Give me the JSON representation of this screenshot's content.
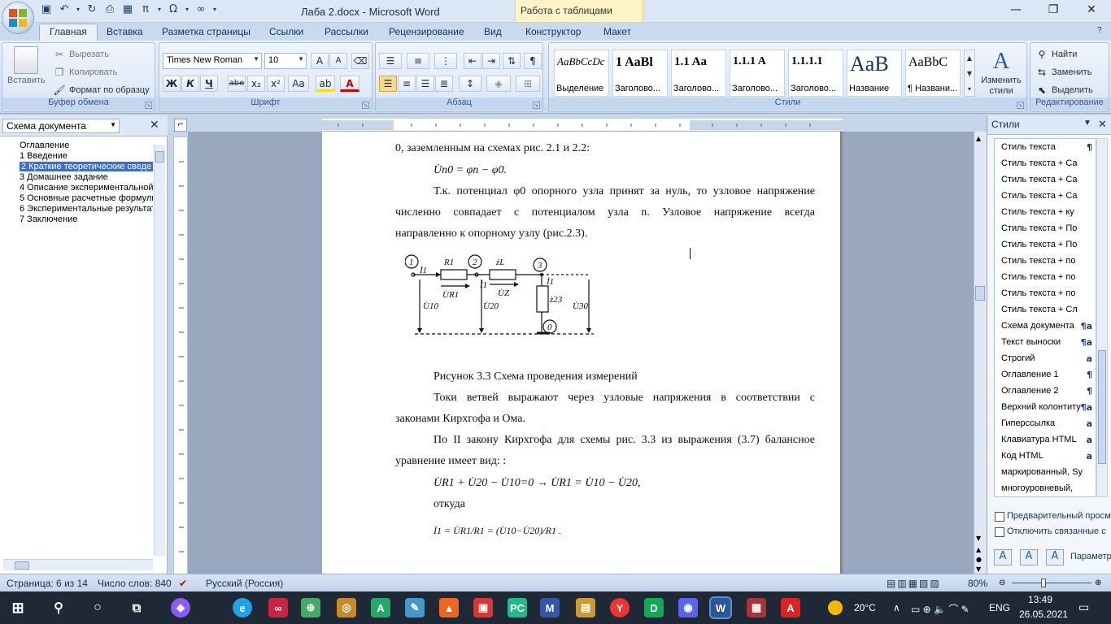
{
  "window": {
    "title": "Лаба 2.docx - Microsoft Word",
    "context_tab_group": "Работа с таблицами",
    "controls": {
      "minimize": "—",
      "restore": "❐",
      "close": "✕"
    }
  },
  "qat": {
    "undo_icon": "undo-icon",
    "redo_icon": "redo-icon",
    "pi": "π",
    "omega": "Ω",
    "inf": "∞"
  },
  "tabs": [
    "Главная",
    "Вставка",
    "Разметка страницы",
    "Ссылки",
    "Рассылки",
    "Рецензирование",
    "Вид",
    "Конструктор",
    "Макет"
  ],
  "ribbon": {
    "clipboard": {
      "label": "Буфер обмена",
      "paste": "Вставить",
      "cut": "Вырезать",
      "copy": "Копировать",
      "format_painter": "Формат по образцу"
    },
    "font": {
      "label": "Шрифт",
      "font_name": "Times New Roman",
      "font_size": "10",
      "bold": "Ж",
      "italic": "К",
      "underline": "Ч",
      "strike": "abe",
      "sub": "x₂",
      "sup": "x²",
      "case": "Aa",
      "grow": "A",
      "shrink": "A"
    },
    "paragraph": {
      "label": "Абзац"
    },
    "styles": {
      "label": "Стили",
      "items": [
        {
          "preview": "AaBbCcDc",
          "name": "Выделение"
        },
        {
          "preview": "1  AaBl",
          "name": "Заголово..."
        },
        {
          "preview": "1.1  Aa",
          "name": "Заголово..."
        },
        {
          "preview": "1.1.1  A",
          "name": "Заголово..."
        },
        {
          "preview": "1.1.1.1",
          "name": "Заголово..."
        },
        {
          "preview": "AaB",
          "name": "Название"
        },
        {
          "preview": "AaBbC",
          "name": "¶ Названи..."
        }
      ],
      "change": "Изменить стили"
    },
    "editing": {
      "label": "Редактирование",
      "find": "Найти",
      "replace": "Заменить",
      "select": "Выделить"
    }
  },
  "docmap": {
    "selector": "Схема документа",
    "items": [
      "Оглавление",
      "1 Введение",
      "2 Краткие теоретические сведе",
      "3 Домашнее задание",
      "4 Описание экспериментальной",
      "5 Основные расчетные формулы",
      "6 Экспериментальные результаты",
      "7 Заключение"
    ],
    "selected_index": 2
  },
  "document": {
    "line1": "0, заземленным на схемах рис. 2.1 и 2.2:",
    "formula1": "U̇n0 = φn − φ0.",
    "para1_l1": "Т.к. потенциал φ0 опорного узла принят за нуль, то узловое напряжение",
    "para1_l2": "численно совпадает с потенциалом узла n. Узловое напряжение всегда",
    "para1_l3": "направленно к опорному узлу (рис.2.3).",
    "caption": "Рисунок 3.3 Схема проведения измерений",
    "para2_l1": "Токи ветвей выражают через узловые напряжения в соответствии с",
    "para2_l2": "законами Кирхгофа и Ома.",
    "para3_l1": "По II закону Кирхгофа для схемы рис. 3.3 из выражения (3.7) балансное",
    "para3_l2": "уравнение имеет вид: :",
    "formula2": "U̇R1 + U̇20 − U̇10=0 → U̇R1 = U̇10 − U̇20,",
    "whence": "откуда",
    "formula3": "İ1 = U̇R1/R1 = (U̇10−U̇20)/R1 .",
    "circuit": {
      "n1": "1",
      "n2": "2",
      "n3": "3",
      "n0": "0",
      "R1": "R1",
      "ZL": "żL",
      "Z23": "ż23",
      "I1": "İ1",
      "UR1": "U̇R1",
      "UZ": "U̇Z",
      "U10": "U̇10",
      "U20": "U̇20",
      "U30": "U̇30"
    }
  },
  "styles_pane": {
    "title": "Стили",
    "items": [
      {
        "name": "Стиль текста",
        "mark": "¶"
      },
      {
        "name": "Стиль текста + Са",
        "mark": ""
      },
      {
        "name": "Стиль текста + Са",
        "mark": ""
      },
      {
        "name": "Стиль текста + Са",
        "mark": ""
      },
      {
        "name": "Стиль текста + ку",
        "mark": ""
      },
      {
        "name": "Стиль текста + По",
        "mark": ""
      },
      {
        "name": "Стиль текста + По",
        "mark": ""
      },
      {
        "name": "Стиль текста + по",
        "mark": ""
      },
      {
        "name": "Стиль текста + по",
        "mark": ""
      },
      {
        "name": "Стиль текста + по",
        "mark": ""
      },
      {
        "name": "Стиль текста + Сл",
        "mark": ""
      },
      {
        "name": "Схема документа",
        "mark": "¶a"
      },
      {
        "name": "Текст выноски",
        "mark": "¶a"
      },
      {
        "name": "Строгий",
        "mark": "a"
      },
      {
        "name": "Оглавление 1",
        "mark": "¶"
      },
      {
        "name": "Оглавление 2",
        "mark": "¶"
      },
      {
        "name": "Верхний колонтиту",
        "mark": "¶a"
      },
      {
        "name": "Гиперссылка",
        "mark": "a"
      },
      {
        "name": "Клавиатура HTML",
        "mark": "a"
      },
      {
        "name": "Код HTML",
        "mark": "a"
      },
      {
        "name": "маркированный, Sy",
        "mark": ""
      },
      {
        "name": "многоуровневый, ",
        "mark": ""
      }
    ],
    "preview_label": "Предварительный просм",
    "disable_linked_label": "Отключить связанные с",
    "options": "Параметр"
  },
  "statusbar": {
    "page": "Страница: 6 из 14",
    "words": "Число слов: 840",
    "language": "Русский (Россия)",
    "zoom": "80%"
  },
  "taskbar": {
    "weather": "20°C",
    "lang": "ENG",
    "time": "13:49",
    "date": "26.05.2021"
  }
}
